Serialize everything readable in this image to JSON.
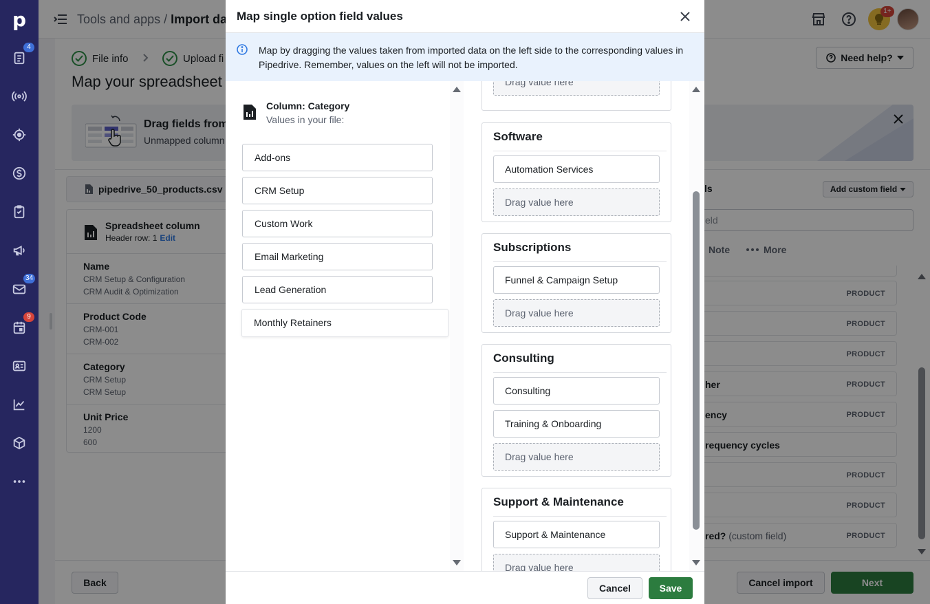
{
  "sidebar": {
    "logo": "p",
    "items": [
      {
        "icon": "deals-icon",
        "badge": "4",
        "badge_color": "#3e6fd8"
      },
      {
        "icon": "leads-icon"
      },
      {
        "icon": "target-icon"
      },
      {
        "icon": "dollar-icon"
      },
      {
        "icon": "tasks-icon"
      },
      {
        "icon": "campaigns-icon"
      },
      {
        "icon": "mail-icon",
        "badge": "34",
        "badge_color": "#3e6fd8"
      },
      {
        "icon": "calendar-icon",
        "badge": "9",
        "badge_color": "#d6443a"
      },
      {
        "icon": "contacts-icon"
      },
      {
        "icon": "insights-icon"
      },
      {
        "icon": "products-icon"
      },
      {
        "icon": "more-icon"
      }
    ]
  },
  "header": {
    "breadcrumb_parent": "Tools and apps",
    "breadcrumb_sep": "/",
    "breadcrumb_current": "Import dat",
    "notification_badge": "1+"
  },
  "steps": [
    {
      "label": "File info"
    },
    {
      "label": "Upload fi"
    }
  ],
  "need_help": "Need help?",
  "page_title": "Map your spreadsheet",
  "banner": {
    "title": "Drag fields from",
    "subtitle": "Unmapped column"
  },
  "file_name": "pipedrive_50_products.csv",
  "spreadsheet": {
    "title": "Spreadsheet column",
    "header_row": "Header row: 1",
    "edit": "Edit",
    "fields": [
      {
        "name": "Name",
        "values": [
          "CRM Setup & Configuration",
          "CRM Audit & Optimization"
        ]
      },
      {
        "name": "Product Code",
        "values": [
          "CRM-001",
          "CRM-002"
        ]
      },
      {
        "name": "Category",
        "values": [
          "CRM Setup",
          "CRM Setup"
        ]
      },
      {
        "name": "Unit Price",
        "values": [
          "1200",
          "600"
        ]
      }
    ]
  },
  "fields_panel": {
    "title_fragment": "ls",
    "add_custom": "Add custom field",
    "search_placeholder": "eld",
    "note": "Note",
    "more": "More",
    "rows": [
      {
        "label": "",
        "tag": "PRODUCT"
      },
      {
        "label": "",
        "tag": "PRODUCT"
      },
      {
        "label": "",
        "tag": "PRODUCT"
      },
      {
        "label": "her",
        "tag": "PRODUCT"
      },
      {
        "label": "ency",
        "tag": "PRODUCT"
      },
      {
        "label": "requency cycles",
        "tag": ""
      },
      {
        "label": "",
        "tag": "PRODUCT"
      },
      {
        "label": "",
        "tag": "PRODUCT"
      },
      {
        "label": "red?",
        "suffix": "(custom field)",
        "tag": "PRODUCT"
      }
    ]
  },
  "bottom": {
    "back": "Back",
    "cancel_import": "Cancel import",
    "next": "Next"
  },
  "modal": {
    "title": "Map single option field values",
    "info": "Map by dragging the values taken from imported data on the left side to the corresponding values in Pipedrive. Remember, values on the left will not be imported.",
    "column_title": "Column: Category",
    "column_sub": "Values in your file:",
    "source_values": [
      "Add-ons",
      "CRM Setup",
      "Custom Work",
      "Email Marketing",
      "Lead Generation"
    ],
    "dragging_value": "Monthly Retainers",
    "drop_placeholder": "Drag value here",
    "groups": [
      {
        "title": "Software",
        "options": [
          "Automation Services"
        ]
      },
      {
        "title": "Subscriptions",
        "options": [
          "Funnel & Campaign Setup"
        ]
      },
      {
        "title": "Consulting",
        "options": [
          "Consulting",
          "Training & Onboarding"
        ]
      },
      {
        "title": "Support & Maintenance",
        "options": [
          "Support & Maintenance"
        ]
      }
    ],
    "cancel": "Cancel",
    "save": "Save"
  }
}
